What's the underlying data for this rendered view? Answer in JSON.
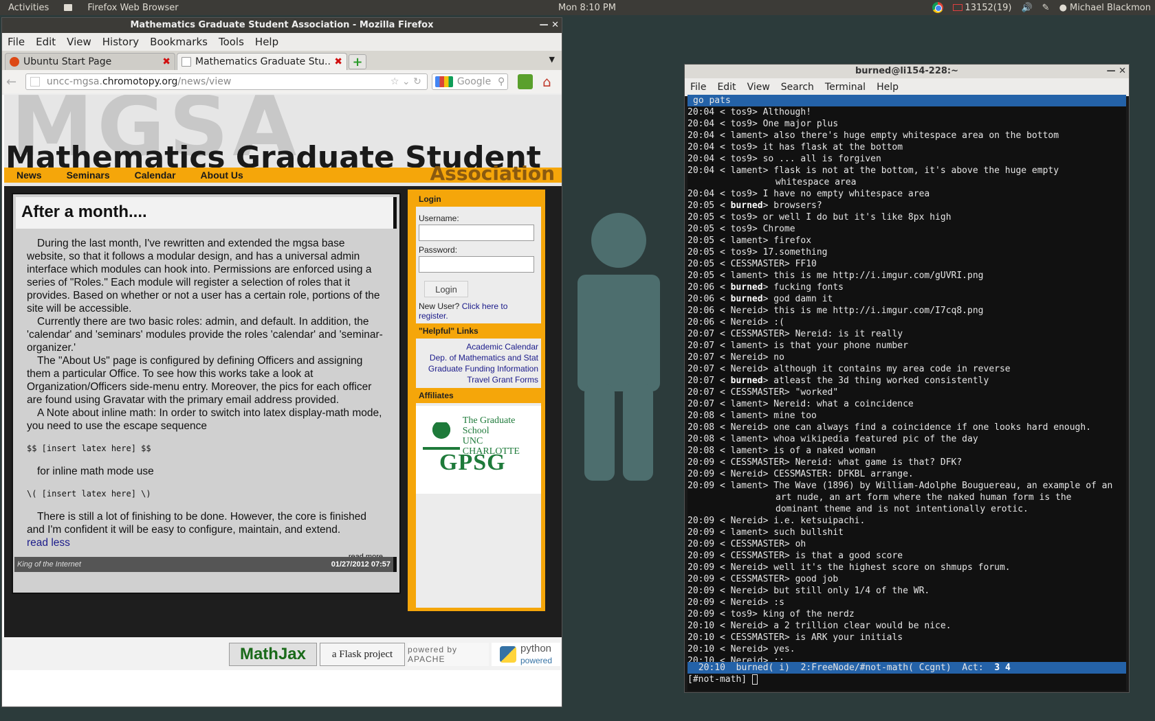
{
  "panel": {
    "activities": "Activities",
    "app_name": "Firefox Web Browser",
    "clock": "Mon  8:10 PM",
    "mail": "13152(19)",
    "user": "Michael Blackmon"
  },
  "firefox": {
    "title": "Mathematics Graduate Student Association - Mozilla Firefox",
    "menu": [
      "File",
      "Edit",
      "View",
      "History",
      "Bookmarks",
      "Tools",
      "Help"
    ],
    "tabs": [
      {
        "label": "Ubuntu Start Page",
        "active": false
      },
      {
        "label": "Mathematics Graduate Stu...",
        "active": true
      }
    ],
    "url": {
      "prefix": "uncc-mgsa.",
      "domain": "chromotopy.org",
      "path": "/news/view"
    },
    "search_placeholder": "Google"
  },
  "site": {
    "bg_logo": "MGSA",
    "title": "Mathematics Graduate Student",
    "title_tail": "Association",
    "nav": [
      "News",
      "Seminars",
      "Calendar",
      "About Us"
    ],
    "article": {
      "title": "After a month....",
      "p1": "During the last month, I've rewritten and extended the mgsa base website, so that it follows a modular design, and has a universal admin interface which modules can hook into. Permissions are enforced using a series of \"Roles.\" Each module will register a selection of roles that it provides. Based on whether or not a user has a certain role, portions of the site will be accessible.",
      "p2": "Currently there are two basic roles: admin, and default. In addition, the 'calendar' and 'seminars' modules provide the roles 'calendar' and 'seminar-organizer.'",
      "p3": "The \"About Us\" page is configured by defining Officers and assigning them a particular Office. To see how this works take a look at Organization/Officers side-menu entry. Moreover, the pics for each officer are found using Gravatar with the primary email address provided.",
      "p4": "A Note about inline math: In order to switch into latex display-math mode, you need to use the escape sequence",
      "code1": "$$ [insert latex here] $$",
      "p5": "for inline math mode use",
      "code2": "\\( [insert latex here] \\)",
      "p6": "There is still a lot of finishing to be done. However, the core is finished and I'm confident it will be easy to configure, maintain, and extend.",
      "read_less": "read less",
      "read_more": "read more",
      "author": "King of the Internet",
      "date": "01/27/2012 07:57"
    },
    "sidebar": {
      "login_head": "Login",
      "username_label": "Username:",
      "password_label": "Password:",
      "login_button": "Login",
      "new_user": "New User?",
      "register_link": "Click here to register.",
      "links_head": "\"Helpful\" Links",
      "links": [
        "Academic Calendar",
        "Dep. of Mathematics and Stat",
        "Graduate Funding Information",
        "Travel Grant Forms"
      ],
      "affiliates_head": "Affiliates",
      "unc_line1": "The Graduate School",
      "unc_line2": "UNC CHARLOTTE",
      "gpsg": "GPSG"
    },
    "footer": {
      "mathjax": "MathJax",
      "mathjax_top": "POWERED BY",
      "flask": "a Flask project",
      "apache": "powered by APACHE",
      "python": "python",
      "python_sub": "powered"
    }
  },
  "terminal": {
    "title": "burned@li154-228:~",
    "menu": [
      "File",
      "Edit",
      "View",
      "Search",
      "Terminal",
      "Help"
    ],
    "topic": "go pats",
    "lines": [
      {
        "t": "20:04",
        "n": "tos9",
        "b": false,
        "m": "Although!"
      },
      {
        "t": "20:04",
        "n": "tos9",
        "b": false,
        "m": "One major plus"
      },
      {
        "t": "20:04",
        "n": "lament",
        "b": false,
        "m": "also there's huge empty whitespace area on the bottom"
      },
      {
        "t": "20:04",
        "n": "tos9",
        "b": false,
        "m": "it has flask at the bottom"
      },
      {
        "t": "20:04",
        "n": "tos9",
        "b": false,
        "m": "so ... all is forgiven"
      },
      {
        "t": "20:04",
        "n": "lament",
        "b": false,
        "m": "flask is not at the bottom, it's above the huge empty",
        "c": "whitespace area"
      },
      {
        "t": "20:04",
        "n": "tos9",
        "b": false,
        "m": "I have no empty whitespace area"
      },
      {
        "t": "20:05",
        "n": "burned",
        "b": true,
        "m": "browsers?"
      },
      {
        "t": "20:05",
        "n": "tos9",
        "b": false,
        "m": "or well I do but it's like 8px high"
      },
      {
        "t": "20:05",
        "n": "tos9",
        "b": false,
        "m": "Chrome"
      },
      {
        "t": "20:05",
        "n": "lament",
        "b": false,
        "m": "firefox"
      },
      {
        "t": "20:05",
        "n": "tos9",
        "b": false,
        "m": "17.something"
      },
      {
        "t": "20:05",
        "n": "CESSMASTER",
        "b": false,
        "m": "FF10"
      },
      {
        "t": "20:05",
        "n": "lament",
        "b": false,
        "m": "this is me http://i.imgur.com/gUVRI.png"
      },
      {
        "t": "20:06",
        "n": "burned",
        "b": true,
        "m": "fucking fonts"
      },
      {
        "t": "20:06",
        "n": "burned",
        "b": true,
        "m": "god damn it"
      },
      {
        "t": "20:06",
        "n": "Nereid",
        "b": false,
        "m": "this is me http://i.imgur.com/I7cq8.png"
      },
      {
        "t": "20:06",
        "n": "Nereid",
        "b": false,
        "m": ":("
      },
      {
        "t": "20:07",
        "n": "CESSMASTER",
        "b": false,
        "m": "Nereid: is it really"
      },
      {
        "t": "20:07",
        "n": "lament",
        "b": false,
        "m": "is that your phone number"
      },
      {
        "t": "20:07",
        "n": "Nereid",
        "b": false,
        "m": "no"
      },
      {
        "t": "20:07",
        "n": "Nereid",
        "b": false,
        "m": "although it contains my area code in reverse"
      },
      {
        "t": "20:07",
        "n": "burned",
        "b": true,
        "m": "atleast the 3d thing worked consistently"
      },
      {
        "t": "20:07",
        "n": "CESSMASTER",
        "b": false,
        "m": "\"worked\""
      },
      {
        "t": "20:07",
        "n": "lament",
        "b": false,
        "m": "Nereid: what a coincidence"
      },
      {
        "t": "20:08",
        "n": "lament",
        "b": false,
        "m": "mine too"
      },
      {
        "t": "20:08",
        "n": "Nereid",
        "b": false,
        "m": "one can always find a coincidence if one looks hard enough."
      },
      {
        "t": "20:08",
        "n": "lament",
        "b": false,
        "m": "whoa wikipedia featured pic of the day"
      },
      {
        "t": "20:08",
        "n": "lament",
        "b": false,
        "m": "is of a naked woman"
      },
      {
        "t": "20:09",
        "n": "CESSMASTER",
        "b": false,
        "m": "Nereid: what game is that? DFK?"
      },
      {
        "t": "20:09",
        "n": "Nereid",
        "b": false,
        "m": "CESSMASTER: DFKBL arrange."
      },
      {
        "t": "20:09",
        "n": "lament",
        "b": false,
        "m": "The Wave (1896) by William-Adolphe Bouguereau, an example of an",
        "c": "art nude, an art form where the naked human form is the",
        "c2": "dominant theme and is not intentionally erotic."
      },
      {
        "t": "20:09",
        "n": "Nereid",
        "b": false,
        "m": "i.e. ketsuipachi."
      },
      {
        "t": "20:09",
        "n": "lament",
        "b": false,
        "m": "such bullshit"
      },
      {
        "t": "20:09",
        "n": "CESSMASTER",
        "b": false,
        "m": "oh"
      },
      {
        "t": "20:09",
        "n": "CESSMASTER",
        "b": false,
        "m": "is that a good score"
      },
      {
        "t": "20:09",
        "n": "Nereid",
        "b": false,
        "m": "well it's the highest score on shmups forum."
      },
      {
        "t": "20:09",
        "n": "CESSMASTER",
        "b": false,
        "m": "good job"
      },
      {
        "t": "20:09",
        "n": "Nereid",
        "b": false,
        "m": "but still only 1/4 of the WR."
      },
      {
        "t": "20:09",
        "n": "Nereid",
        "b": false,
        "m": ":s"
      },
      {
        "t": "20:09",
        "n": "tos9",
        "b": false,
        "m": "king of the nerdz"
      },
      {
        "t": "20:10",
        "n": "Nereid",
        "b": false,
        "m": "a 2 trillion clear would be nice."
      },
      {
        "t": "20:10",
        "n": "CESSMASTER",
        "b": false,
        "m": "is ARK your initials"
      },
      {
        "t": "20:10",
        "n": "Nereid",
        "b": false,
        "m": "yes."
      },
      {
        "t": "20:10",
        "n": "Nereid",
        "b": false,
        "m": ";;"
      }
    ],
    "status": {
      "time": "20:10",
      "nick": "burned( i)",
      "window": "2:FreeNode/#not-math( Ccgnt)",
      "act_label": "Act:",
      "act": "3 4"
    },
    "prompt": "[#not-math]"
  }
}
